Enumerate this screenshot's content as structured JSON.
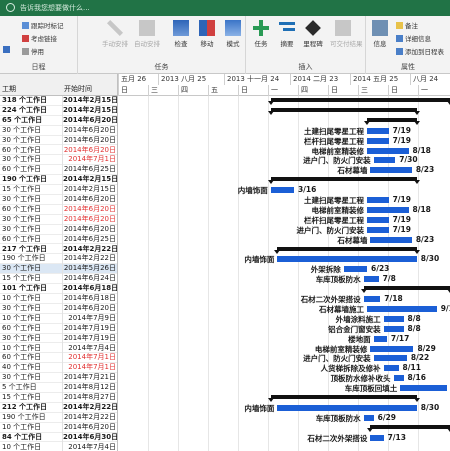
{
  "ribbon": {
    "search_placeholder": "告诉我您想要做什么...",
    "groups": {
      "schedule": "日程",
      "tasks": "任务",
      "insert": "插入",
      "properties": "属性"
    },
    "schedule_items": {
      "mark_on_track": "跟踪时标记",
      "respect_links": "考虑链接",
      "inactivate": "停用"
    },
    "task_buttons": {
      "manual": "手动安排",
      "auto": "自动安排",
      "inspect": "检查",
      "move": "移动",
      "mode": "模式"
    },
    "insert_buttons": {
      "task": "任务",
      "summary": "摘要",
      "milestone": "里程碑",
      "deliverable": "可交付结果"
    },
    "properties_buttons": {
      "info": "信息",
      "notes": "备注",
      "details": "详细信息",
      "add_to_timeline": "添加到日程表"
    }
  },
  "grid_header": {
    "duration": "工期",
    "start": "开始时间"
  },
  "timeline": {
    "months": [
      "五月 26",
      "2013 八月 25",
      "2013 十一月 24",
      "2014 二月 23",
      "2014 五月 25",
      "八月 24"
    ],
    "subs": [
      "日",
      "三",
      "四",
      "五",
      "日",
      "一",
      "四",
      "日",
      "三",
      "日",
      "一"
    ]
  },
  "rows": [
    {
      "dur": "318 个工作日",
      "start": "2014年2月15日",
      "sum": true
    },
    {
      "dur": "224 个工作日",
      "start": "2014年2月15日",
      "sum": true
    },
    {
      "dur": "65 个工作日",
      "start": "2014年6月20日",
      "sum": true
    },
    {
      "dur": "30 个工作日",
      "start": "2014年6月20日"
    },
    {
      "dur": "30 个工作日",
      "start": "2014年6月20日"
    },
    {
      "dur": "60 个工作日",
      "start": "2014年6月20日",
      "red": true
    },
    {
      "dur": "30 个工作日",
      "start": "2014年7月1日",
      "red": true
    },
    {
      "dur": "60 个工作日",
      "start": "2014年6月25日"
    },
    {
      "dur": "190 个工作日",
      "start": "2014年2月15日",
      "sum": true
    },
    {
      "dur": "15 个工作日",
      "start": "2014年2月15日"
    },
    {
      "dur": "30 个工作日",
      "start": "2014年6月20日"
    },
    {
      "dur": "60 个工作日",
      "start": "2014年6月20日",
      "red": true
    },
    {
      "dur": "30 个工作日",
      "start": "2014年6月20日",
      "red": true
    },
    {
      "dur": "30 个工作日",
      "start": "2014年6月20日"
    },
    {
      "dur": "60 个工作日",
      "start": "2014年6月25日"
    },
    {
      "dur": "217 个工作日",
      "start": "2014年2月22日",
      "sum": true
    },
    {
      "dur": "190 个工作日",
      "start": "2014年2月22日"
    },
    {
      "dur": "30 个工作日",
      "start": "2014年5月26日",
      "sel": true
    },
    {
      "dur": "15 个工作日",
      "start": "2014年6月24日"
    },
    {
      "dur": "101 个工作日",
      "start": "2014年6月18日",
      "sum": true
    },
    {
      "dur": "10 个工作日",
      "start": "2014年6月18日"
    },
    {
      "dur": "30 个工作日",
      "start": "2014年6月20日"
    },
    {
      "dur": "10 个工作日",
      "start": "2014年7月9日"
    },
    {
      "dur": "60 个工作日",
      "start": "2014年7月19日"
    },
    {
      "dur": "30 个工作日",
      "start": "2014年7月19日"
    },
    {
      "dur": "10 个工作日",
      "start": "2014年7月4日"
    },
    {
      "dur": "60 个工作日",
      "start": "2014年7月1日",
      "red": true
    },
    {
      "dur": "40 个工作日",
      "start": "2014年7月1日",
      "red": true
    },
    {
      "dur": "30 个工作日",
      "start": "2014年7月21日"
    },
    {
      "dur": "5 个工作日",
      "start": "2014年8月12日"
    },
    {
      "dur": "15 个工作日",
      "start": "2014年8月27日"
    },
    {
      "dur": "212 个工作日",
      "start": "2014年2月22日",
      "sum": true
    },
    {
      "dur": "190 个工作日",
      "start": "2014年2月22日"
    },
    {
      "dur": "10 个工作日",
      "start": "2014年6月20日"
    },
    {
      "dur": "84 个工作日",
      "start": "2014年6月30日",
      "sum": true
    },
    {
      "dur": "10 个工作日",
      "start": "2014年7月4日"
    }
  ],
  "gantt": [
    {
      "row": 0,
      "type": "sum",
      "from": 0.46,
      "to": 1.0
    },
    {
      "row": 1,
      "type": "sum",
      "from": 0.46,
      "to": 0.9
    },
    {
      "row": 2,
      "type": "sum",
      "from": 0.75,
      "to": 0.9
    },
    {
      "row": 3,
      "name": "土建扫尾零星工程",
      "label": "7/19",
      "from": 0.75,
      "to": 0.815
    },
    {
      "row": 4,
      "name": "栏杆扫尾零星工程",
      "label": "7/19",
      "from": 0.75,
      "to": 0.815
    },
    {
      "row": 5,
      "name": "电梯前室精装修",
      "label": "8/18",
      "from": 0.75,
      "to": 0.875
    },
    {
      "row": 6,
      "name": "进户门、防火门安装",
      "label": "7/30",
      "from": 0.77,
      "to": 0.835
    },
    {
      "row": 7,
      "name": "石材幕墙",
      "label": "8/23",
      "from": 0.76,
      "to": 0.885
    },
    {
      "row": 8,
      "type": "sum",
      "from": 0.46,
      "to": 0.9
    },
    {
      "row": 9,
      "name": "内墙饰面",
      "label": "3/16",
      "from": 0.46,
      "to": 0.53
    },
    {
      "row": 10,
      "name": "土建扫尾零星工程",
      "label": "7/19",
      "from": 0.75,
      "to": 0.815
    },
    {
      "row": 11,
      "name": "电梯前室精装修",
      "label": "8/18",
      "from": 0.75,
      "to": 0.875
    },
    {
      "row": 12,
      "name": "栏杆扫尾零星工程",
      "label": "7/19",
      "from": 0.75,
      "to": 0.815
    },
    {
      "row": 13,
      "name": "进户门、防火门安装",
      "label": "7/19",
      "from": 0.75,
      "to": 0.815
    },
    {
      "row": 14,
      "name": "石材幕墙",
      "label": "8/23",
      "from": 0.76,
      "to": 0.885
    },
    {
      "row": 15,
      "type": "sum",
      "from": 0.48,
      "to": 0.9
    },
    {
      "row": 16,
      "name": "内墙饰面",
      "label": "8/30",
      "from": 0.48,
      "to": 0.9
    },
    {
      "row": 17,
      "name": "外架拆除",
      "label": "6/23",
      "from": 0.68,
      "to": 0.75
    },
    {
      "row": 18,
      "name": "车库顶板防水",
      "label": "7/8",
      "from": 0.74,
      "to": 0.785
    },
    {
      "row": 19,
      "type": "sum",
      "from": 0.74,
      "to": 1.0
    },
    {
      "row": 20,
      "name": "石材二次外架搭设",
      "label": "7/18",
      "from": 0.74,
      "to": 0.79
    },
    {
      "row": 21,
      "name": "石材幕墙施工",
      "label": "9/12",
      "from": 0.75,
      "to": 0.96
    },
    {
      "row": 22,
      "name": "外墙涂料施工",
      "label": "8/8",
      "from": 0.8,
      "to": 0.86
    },
    {
      "row": 23,
      "name": "铝合金门窗安装",
      "label": "8/8",
      "from": 0.8,
      "to": 0.86
    },
    {
      "row": 24,
      "name": "楼地面",
      "label": "7/17",
      "from": 0.77,
      "to": 0.81
    },
    {
      "row": 25,
      "name": "电梯前室精装修",
      "label": "8/29",
      "from": 0.76,
      "to": 0.89
    },
    {
      "row": 26,
      "name": "进户门、防火门安装",
      "label": "8/22",
      "from": 0.77,
      "to": 0.87
    },
    {
      "row": 27,
      "name": "人货梯拆除及修补",
      "label": "8/11",
      "from": 0.8,
      "to": 0.845
    },
    {
      "row": 28,
      "name": "顶板防水修补收头",
      "label": "8/16",
      "from": 0.83,
      "to": 0.86
    },
    {
      "row": 29,
      "name": "车库顶板回填土",
      "label": "9/27",
      "from": 0.85,
      "to": 0.99
    },
    {
      "row": 30,
      "type": "sum",
      "from": 0.46,
      "to": 0.9
    },
    {
      "row": 31,
      "name": "内墙饰面",
      "label": "8/30",
      "from": 0.48,
      "to": 0.9
    },
    {
      "row": 32,
      "name": "车库顶板防水",
      "label": "6/29",
      "from": 0.74,
      "to": 0.77
    },
    {
      "row": 33,
      "type": "sum",
      "from": 0.76,
      "to": 1.0
    },
    {
      "row": 34,
      "name": "石材二次外架搭设",
      "label": "7/13",
      "from": 0.76,
      "to": 0.8
    }
  ]
}
